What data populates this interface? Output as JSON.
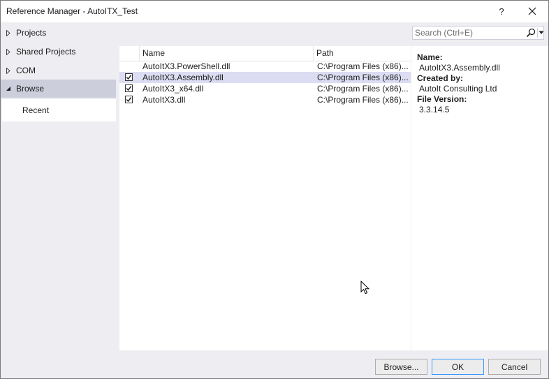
{
  "window": {
    "title": "Reference Manager - AutoITX_Test",
    "help_label": "?"
  },
  "nav": {
    "items": [
      {
        "label": "Projects",
        "expanded": false
      },
      {
        "label": "Shared Projects",
        "expanded": false
      },
      {
        "label": "COM",
        "expanded": false
      },
      {
        "label": "Browse",
        "expanded": true,
        "selected": true
      }
    ],
    "sub_items": [
      {
        "label": "Recent"
      }
    ]
  },
  "search": {
    "placeholder": "Search (Ctrl+E)",
    "value": ""
  },
  "list": {
    "columns": [
      "Name",
      "Path"
    ],
    "rows": [
      {
        "name": "AutoItX3.PowerShell.dll",
        "path": "C:\\Program Files (x86)...",
        "checked": false,
        "selected": false
      },
      {
        "name": "AutoItX3.Assembly.dll",
        "path": "C:\\Program Files (x86)...",
        "checked": true,
        "selected": true
      },
      {
        "name": "AutoItX3_x64.dll",
        "path": "C:\\Program Files (x86)...",
        "checked": true,
        "selected": false
      },
      {
        "name": "AutoItX3.dll",
        "path": "C:\\Program Files (x86)...",
        "checked": true,
        "selected": false
      }
    ]
  },
  "details": {
    "name_label": "Name:",
    "name_value": "AutoItX3.Assembly.dll",
    "created_label": "Created by:",
    "created_value": "AutoIt Consulting Ltd",
    "version_label": "File Version:",
    "version_value": "3.3.14.5"
  },
  "footer": {
    "browse_label": "Browse...",
    "ok_label": "OK",
    "cancel_label": "Cancel"
  },
  "colors": {
    "selection": "#dcdcf2",
    "nav_selected": "#cccedb",
    "primary_border": "#3399ff"
  }
}
